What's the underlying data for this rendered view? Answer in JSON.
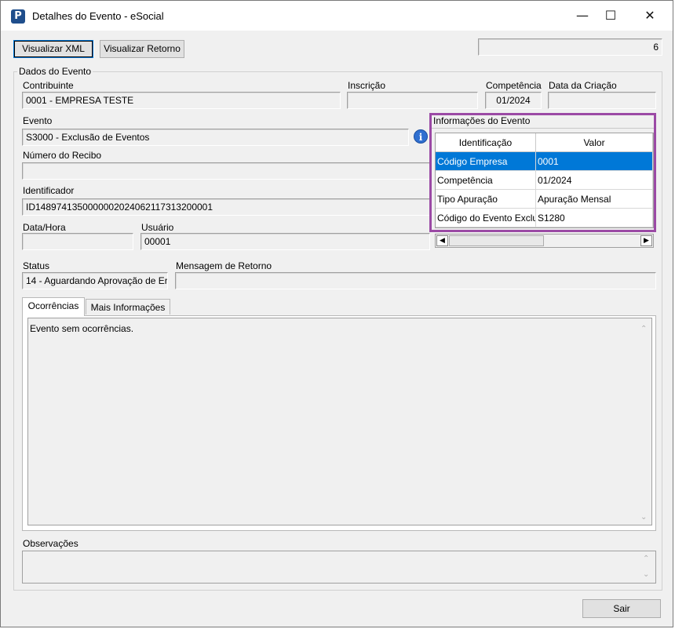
{
  "window": {
    "title": "Detalhes do Evento - eSocial",
    "app_icon_letter": "P"
  },
  "toolbar": {
    "visualizar_xml": "Visualizar XML",
    "visualizar_retorno": "Visualizar Retorno",
    "counter": "6"
  },
  "dados": {
    "caption": "Dados do Evento",
    "contribuinte": {
      "label": "Contribuinte",
      "value": "0001 - EMPRESA TESTE"
    },
    "inscricao": {
      "label": "Inscrição",
      "value": ""
    },
    "competencia": {
      "label": "Competência",
      "value": "01/2024"
    },
    "data_criacao": {
      "label": "Data da Criação",
      "value": ""
    },
    "evento": {
      "label": "Evento",
      "value": "S3000 - Exclusão de Eventos"
    },
    "numero_recibo": {
      "label": "Número do Recibo",
      "value": ""
    },
    "identificador": {
      "label": "Identificador",
      "value": "ID1489741350000002024062117313200001"
    },
    "data_hora": {
      "label": "Data/Hora",
      "value": ""
    },
    "usuario": {
      "label": "Usuário",
      "value": "00001"
    },
    "status": {
      "label": "Status",
      "value": "14 - Aguardando Aprovação de Er"
    },
    "mensagem_retorno": {
      "label": "Mensagem de Retorno",
      "value": ""
    }
  },
  "info_evento": {
    "caption": "Informações do Evento",
    "headers": {
      "identificacao": "Identificação",
      "valor": "Valor"
    },
    "rows": [
      {
        "id": "Código Empresa",
        "valor": "0001"
      },
      {
        "id": "Competência",
        "valor": "01/2024"
      },
      {
        "id": "Tipo Apuração",
        "valor": "Apuração Mensal"
      },
      {
        "id": "Código do Evento Exclu",
        "valor": "S1280"
      }
    ]
  },
  "tabs": {
    "ocorrencias": "Ocorrências",
    "mais_informacoes": "Mais Informações"
  },
  "ocorrencias_text": "Evento sem ocorrências.",
  "observacoes": {
    "label": "Observações",
    "value": ""
  },
  "footer": {
    "sair": "Sair"
  },
  "colors": {
    "selection": "#0078d7",
    "highlight_frame": "#9b4aa5"
  }
}
